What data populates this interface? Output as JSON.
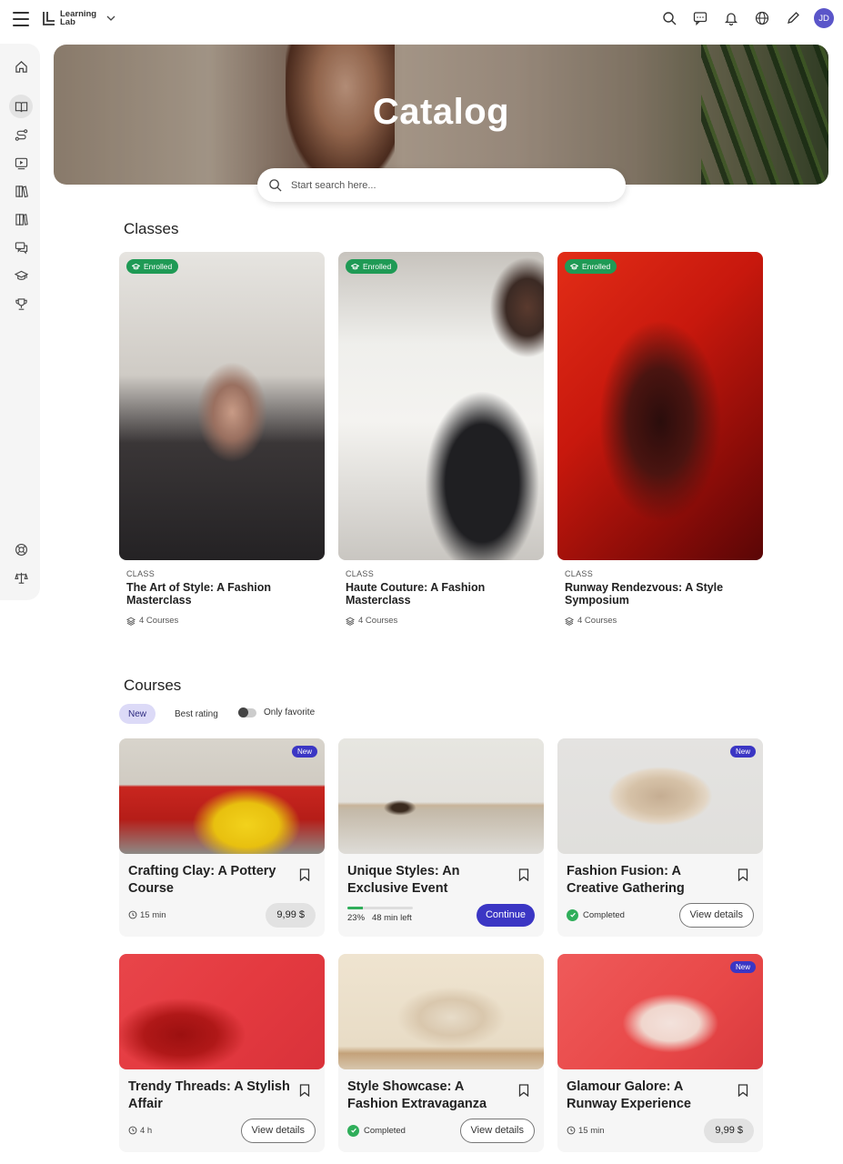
{
  "app": {
    "logo_text": "Learning Lab",
    "user_initials": "JD"
  },
  "colors": {
    "accent": "#3b36c4",
    "enrolled": "#1f9a55",
    "completed": "#2fae5a",
    "filter_active": "#dcdaf7"
  },
  "topbar": {
    "icons": [
      "search-icon",
      "chat-icon",
      "bell-icon",
      "globe-icon",
      "pencil-icon"
    ]
  },
  "sidebar": {
    "items": [
      "home-icon",
      "book-icon",
      "route-icon",
      "video-icon",
      "library-icon",
      "library-2-icon",
      "messages-icon",
      "graduation-icon",
      "trophy-icon"
    ],
    "bottom": [
      "help-icon",
      "scale-icon"
    ]
  },
  "hero": {
    "title": "Catalog",
    "search_placeholder": "Start search here..."
  },
  "classes": {
    "heading": "Classes",
    "items": [
      {
        "badge": "Enrolled",
        "kind": "CLASS",
        "title": "The Art of Style: A Fashion Masterclass",
        "meta": "4 Courses"
      },
      {
        "badge": "Enrolled",
        "kind": "CLASS",
        "title": "Haute Couture: A Fashion Masterclass",
        "meta": "4 Courses"
      },
      {
        "badge": "Enrolled",
        "kind": "CLASS",
        "title": "Runway Rendezvous: A Style Symposium",
        "meta": "4 Courses"
      }
    ]
  },
  "courses": {
    "heading": "Courses",
    "filters": {
      "new": "New",
      "best_rating": "Best rating",
      "only_favorite": "Only favorite"
    },
    "items": [
      {
        "badge": "New",
        "title": "Crafting Clay: A Pottery Course",
        "duration": "15 min",
        "price": "9,99 $"
      },
      {
        "title": "Unique Styles: An Exclusive Event",
        "progress": 23,
        "progress_label": "23%",
        "time_left": "48 min left",
        "action": "Continue"
      },
      {
        "badge": "New",
        "title": "Fashion Fusion: A Creative Gathering",
        "status": "Completed",
        "action": "View details"
      },
      {
        "title": "Trendy Threads: A Stylish Affair",
        "duration": "4 h",
        "action": "View details"
      },
      {
        "title": "Style Showcase: A Fashion Extravaganza",
        "status": "Completed",
        "action": "View details"
      },
      {
        "badge": "New",
        "title": "Glamour Galore: A Runway Experience",
        "duration": "15 min",
        "price": "9,99 $"
      }
    ]
  }
}
